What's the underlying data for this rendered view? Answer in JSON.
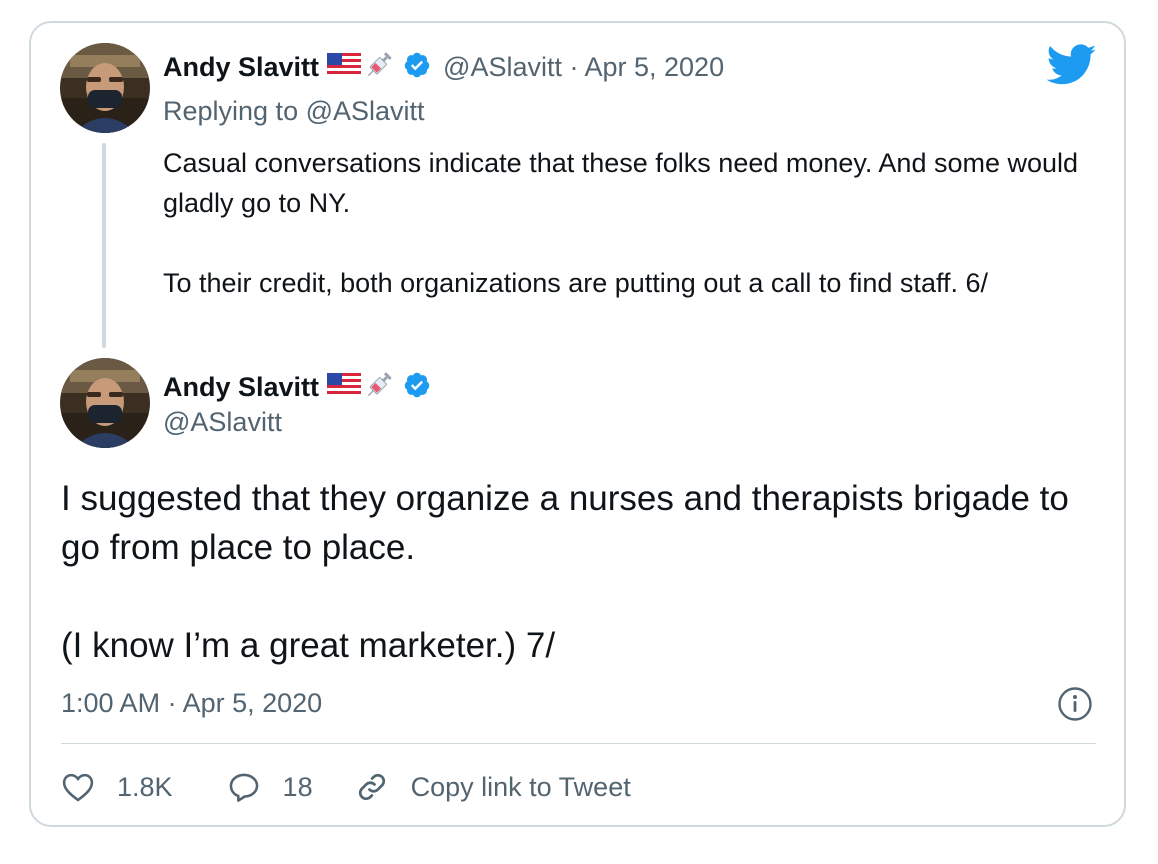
{
  "quoted_tweet": {
    "author_name": "Andy Slavitt",
    "flag_emoji": "🇺🇸",
    "syringe_emoji": "💉",
    "handle_date": "@ASlavitt · Apr 5, 2020",
    "replying_to": "Replying to @ASlavitt",
    "text": "Casual conversations indicate that these folks need money. And some would gladly go to NY.\n\nTo their credit, both organizations are putting out a call to find staff. 6/"
  },
  "main_tweet": {
    "author_name": "Andy Slavitt",
    "flag_emoji": "🇺🇸",
    "syringe_emoji": "💉",
    "handle": "@ASlavitt",
    "text": "I suggested that they organize a nurses and therapists brigade to go from place to place.\n\n(I know I’m a great marketer.) 7/",
    "timestamp": "1:00 AM · Apr 5, 2020"
  },
  "actions": {
    "likes": "1.8K",
    "replies": "18",
    "copy_link": "Copy link to Tweet"
  },
  "icons": [
    "twitter-bird-icon",
    "verified-badge-icon",
    "info-icon",
    "heart-icon",
    "reply-icon",
    "link-icon"
  ],
  "colors": {
    "twitter_blue": "#1d9bf0",
    "secondary_text": "#536471",
    "border": "#cfd9de",
    "primary_text": "#0f1419"
  }
}
